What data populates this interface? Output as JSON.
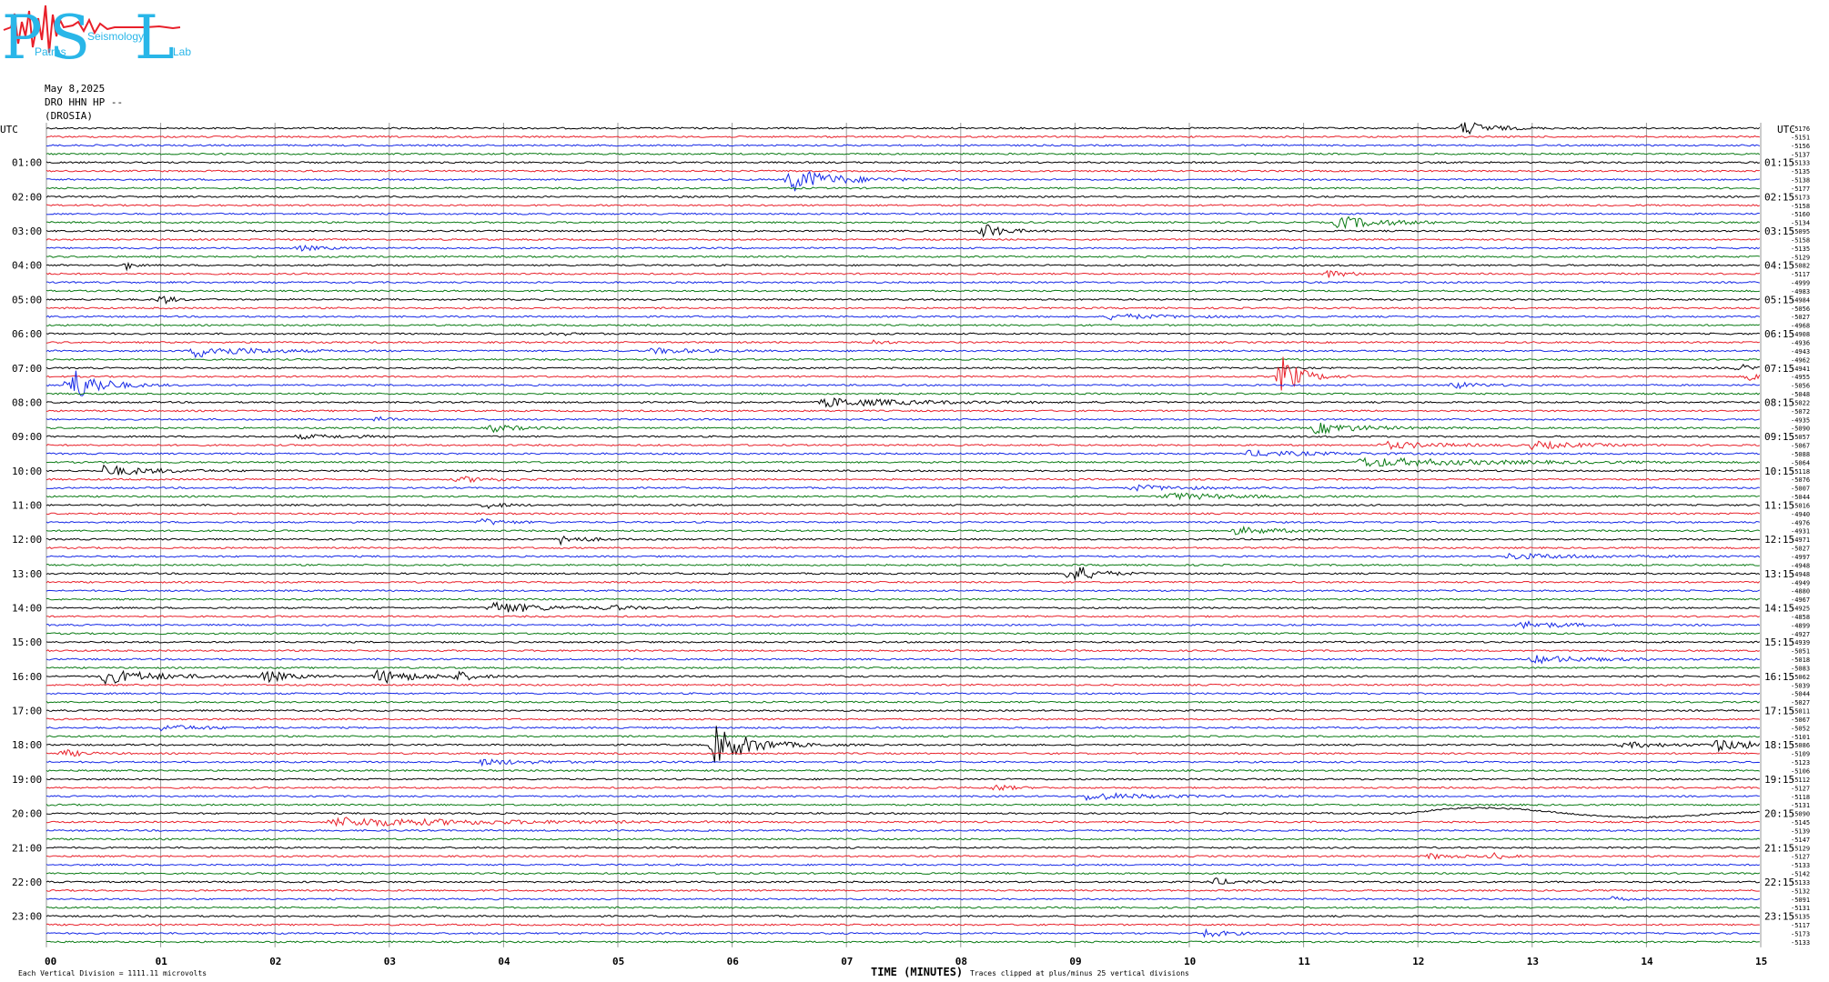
{
  "logo": {
    "letters": [
      "P",
      "S",
      "L"
    ],
    "words": [
      "Patras",
      "Seismology",
      "Lab"
    ],
    "colors": {
      "text": "#29b6e8",
      "scribble": "#e8202a"
    }
  },
  "header": {
    "date": "May 8,2025",
    "station": "DRO HHN HP --",
    "location": "(DROSIA)"
  },
  "colors": {
    "trace_cycle": [
      "#000000",
      "#e8202a",
      "#1528e6",
      "#0a7a14"
    ],
    "grid": "#9a9a9a"
  },
  "chart_data": {
    "type": "line",
    "title": "",
    "left_axis_title": "UTC",
    "right_axis_title": "UTC",
    "xlabel": "TIME (MINUTES)",
    "xlim": [
      0,
      15
    ],
    "x_ticks": [
      "00",
      "01",
      "02",
      "03",
      "04",
      "05",
      "06",
      "07",
      "08",
      "09",
      "10",
      "11",
      "12",
      "13",
      "14",
      "15"
    ],
    "rows_per_hour": 4,
    "row_count": 96,
    "left_labels": [
      "01:00",
      "02:00",
      "03:00",
      "04:00",
      "05:00",
      "06:00",
      "07:00",
      "08:00",
      "09:00",
      "10:00",
      "11:00",
      "12:00",
      "13:00",
      "14:00",
      "15:00",
      "16:00",
      "17:00",
      "18:00",
      "19:00",
      "20:00",
      "21:00",
      "22:00",
      "23:00"
    ],
    "right_labels": [
      "01:15",
      "02:15",
      "03:15",
      "04:15",
      "05:15",
      "06:15",
      "07:15",
      "08:15",
      "09:15",
      "10:15",
      "11:15",
      "12:15",
      "13:15",
      "14:15",
      "15:15",
      "16:15",
      "17:15",
      "18:15",
      "19:15",
      "20:15",
      "21:15",
      "22:15",
      "23:15"
    ],
    "row_offsets": [
      "-5176",
      "-5151",
      "-5156",
      "-5137",
      "-5133",
      "-5135",
      "-5138",
      "-5177",
      "-5173",
      "-5158",
      "-5160",
      "-5134",
      "-5095",
      "-5158",
      "-5135",
      "-5129",
      "-5082",
      "-5117",
      "-4999",
      "-4983",
      "-4984",
      "-5056",
      "-5027",
      "-4968",
      "-4908",
      "-4936",
      "-4943",
      "-4962",
      "-4941",
      "-4955",
      "-5056",
      "-5048",
      "-5022",
      "-5072",
      "-4935",
      "-5090",
      "-5057",
      "-5067",
      "-5088",
      "-5064",
      "-5118",
      "-5076",
      "-5007",
      "-5044",
      "-5016",
      "-4940",
      "-4976",
      "-4931",
      "-4971",
      "-5027",
      "-4997",
      "-4948",
      "-4948",
      "-4949",
      "-4880",
      "-4967",
      "-4925",
      "-4858",
      "-4899",
      "-4927",
      "-4939",
      "-5051",
      "-5018",
      "-5083",
      "-5062",
      "-5039",
      "-5044",
      "-5027",
      "-5011",
      "-5067",
      "-5052",
      "-5101",
      "-5086",
      "-5109",
      "-5123",
      "-5106",
      "-5112",
      "-5127",
      "-5118",
      "-5131",
      "-5090",
      "-5145",
      "-5139",
      "-5147",
      "-5129",
      "-5127",
      "-5133",
      "-5142",
      "-5133",
      "-5132",
      "-5091",
      "-5131",
      "-5135",
      "-5117",
      "-5173",
      "-5133"
    ],
    "events": [
      {
        "row": 0,
        "minute": 12.4,
        "amp": 8,
        "dur": 0.35
      },
      {
        "row": 6,
        "minute": 6.5,
        "amp": 14,
        "dur": 0.55
      },
      {
        "row": 11,
        "minute": 11.3,
        "amp": 7,
        "dur": 0.6
      },
      {
        "row": 12,
        "minute": 8.2,
        "amp": 9,
        "dur": 0.25
      },
      {
        "row": 14,
        "minute": 2.2,
        "amp": 3,
        "dur": 0.3
      },
      {
        "row": 16,
        "minute": 0.7,
        "amp": 5,
        "dur": 0.08
      },
      {
        "row": 17,
        "minute": 11.2,
        "amp": 4,
        "dur": 0.3
      },
      {
        "row": 20,
        "minute": 1.0,
        "amp": 6,
        "dur": 0.15
      },
      {
        "row": 22,
        "minute": 9.3,
        "amp": 3,
        "dur": 0.8
      },
      {
        "row": 24,
        "minute": 4.4,
        "amp": 2,
        "dur": 0.3
      },
      {
        "row": 25,
        "minute": 7.2,
        "amp": 3,
        "dur": 0.2
      },
      {
        "row": 26,
        "minute": 1.3,
        "amp": 7,
        "dur": 0.7
      },
      {
        "row": 26,
        "minute": 5.3,
        "amp": 3,
        "dur": 0.6
      },
      {
        "row": 28,
        "minute": 14.8,
        "amp": 5,
        "dur": 0.15
      },
      {
        "row": 29,
        "minute": 10.8,
        "amp": 24,
        "dur": 0.25
      },
      {
        "row": 29,
        "minute": 14.9,
        "amp": 5,
        "dur": 0.2
      },
      {
        "row": 30,
        "minute": 0.2,
        "amp": 22,
        "dur": 0.35
      },
      {
        "row": 30,
        "minute": 12.3,
        "amp": 4,
        "dur": 0.3
      },
      {
        "row": 32,
        "minute": 6.8,
        "amp": 5,
        "dur": 1.1
      },
      {
        "row": 34,
        "minute": 2.9,
        "amp": 3,
        "dur": 0.15
      },
      {
        "row": 35,
        "minute": 3.9,
        "amp": 4,
        "dur": 0.35
      },
      {
        "row": 35,
        "minute": 11.1,
        "amp": 6,
        "dur": 0.6
      },
      {
        "row": 36,
        "minute": 2.2,
        "amp": 2,
        "dur": 0.8
      },
      {
        "row": 37,
        "minute": 11.7,
        "amp": 4,
        "dur": 0.7
      },
      {
        "row": 37,
        "minute": 13.0,
        "amp": 4,
        "dur": 0.6
      },
      {
        "row": 38,
        "minute": 10.5,
        "amp": 3,
        "dur": 1.0
      },
      {
        "row": 39,
        "minute": 11.5,
        "amp": 5,
        "dur": 1.6
      },
      {
        "row": 40,
        "minute": 0.5,
        "amp": 6,
        "dur": 0.6
      },
      {
        "row": 41,
        "minute": 3.6,
        "amp": 3,
        "dur": 0.5
      },
      {
        "row": 42,
        "minute": 9.5,
        "amp": 3,
        "dur": 0.7
      },
      {
        "row": 43,
        "minute": 9.8,
        "amp": 4,
        "dur": 0.8
      },
      {
        "row": 44,
        "minute": 3.85,
        "amp": 4,
        "dur": 0.2
      },
      {
        "row": 46,
        "minute": 3.8,
        "amp": 4,
        "dur": 0.3
      },
      {
        "row": 47,
        "minute": 10.4,
        "amp": 4,
        "dur": 0.6
      },
      {
        "row": 48,
        "minute": 4.5,
        "amp": 5,
        "dur": 0.3
      },
      {
        "row": 50,
        "minute": 12.8,
        "amp": 3,
        "dur": 1.0
      },
      {
        "row": 52,
        "minute": 8.95,
        "amp": 12,
        "dur": 0.3
      },
      {
        "row": 56,
        "minute": 3.9,
        "amp": 7,
        "dur": 0.6
      },
      {
        "row": 56,
        "minute": 4.9,
        "amp": 3,
        "dur": 0.3
      },
      {
        "row": 58,
        "minute": 12.9,
        "amp": 4,
        "dur": 0.6
      },
      {
        "row": 62,
        "minute": 13.0,
        "amp": 4,
        "dur": 0.8
      },
      {
        "row": 64,
        "minute": 0.5,
        "amp": 8,
        "dur": 0.7
      },
      {
        "row": 64,
        "minute": 1.9,
        "amp": 7,
        "dur": 0.3
      },
      {
        "row": 64,
        "minute": 2.9,
        "amp": 8,
        "dur": 0.5
      },
      {
        "row": 64,
        "minute": 3.6,
        "amp": 5,
        "dur": 0.2
      },
      {
        "row": 70,
        "minute": 1.0,
        "amp": 3,
        "dur": 0.6
      },
      {
        "row": 72,
        "minute": 5.85,
        "amp": 22,
        "dur": 0.45
      },
      {
        "row": 72,
        "minute": 14.6,
        "amp": 6,
        "dur": 0.6
      },
      {
        "row": 72,
        "minute": 13.8,
        "amp": 3,
        "dur": 0.6
      },
      {
        "row": 73,
        "minute": 0.15,
        "amp": 4,
        "dur": 0.25
      },
      {
        "row": 74,
        "minute": 3.8,
        "amp": 3,
        "dur": 0.7
      },
      {
        "row": 77,
        "minute": 8.3,
        "amp": 4,
        "dur": 0.2
      },
      {
        "row": 78,
        "minute": 9.1,
        "amp": 4,
        "dur": 0.8
      },
      {
        "row": 81,
        "minute": 2.5,
        "amp": 5,
        "dur": 2.0
      },
      {
        "row": 85,
        "minute": 12.65,
        "amp": 4,
        "dur": 0.15
      },
      {
        "row": 85,
        "minute": 12.1,
        "amp": 3,
        "dur": 0.3
      },
      {
        "row": 88,
        "minute": 10.2,
        "amp": 4,
        "dur": 0.3
      },
      {
        "row": 90,
        "minute": 13.7,
        "amp": 2,
        "dur": 0.2
      },
      {
        "row": 94,
        "minute": 10.1,
        "amp": 5,
        "dur": 0.3
      }
    ],
    "long_period": {
      "row": 80,
      "from_minute": 11.9,
      "to_minute": 15.0,
      "amp": 7
    }
  },
  "footer": {
    "scale_note": "Each Vertical Division = 1111.11 microvolts",
    "clip_note": "Traces clipped at plus/minus 25 vertical divisions"
  }
}
